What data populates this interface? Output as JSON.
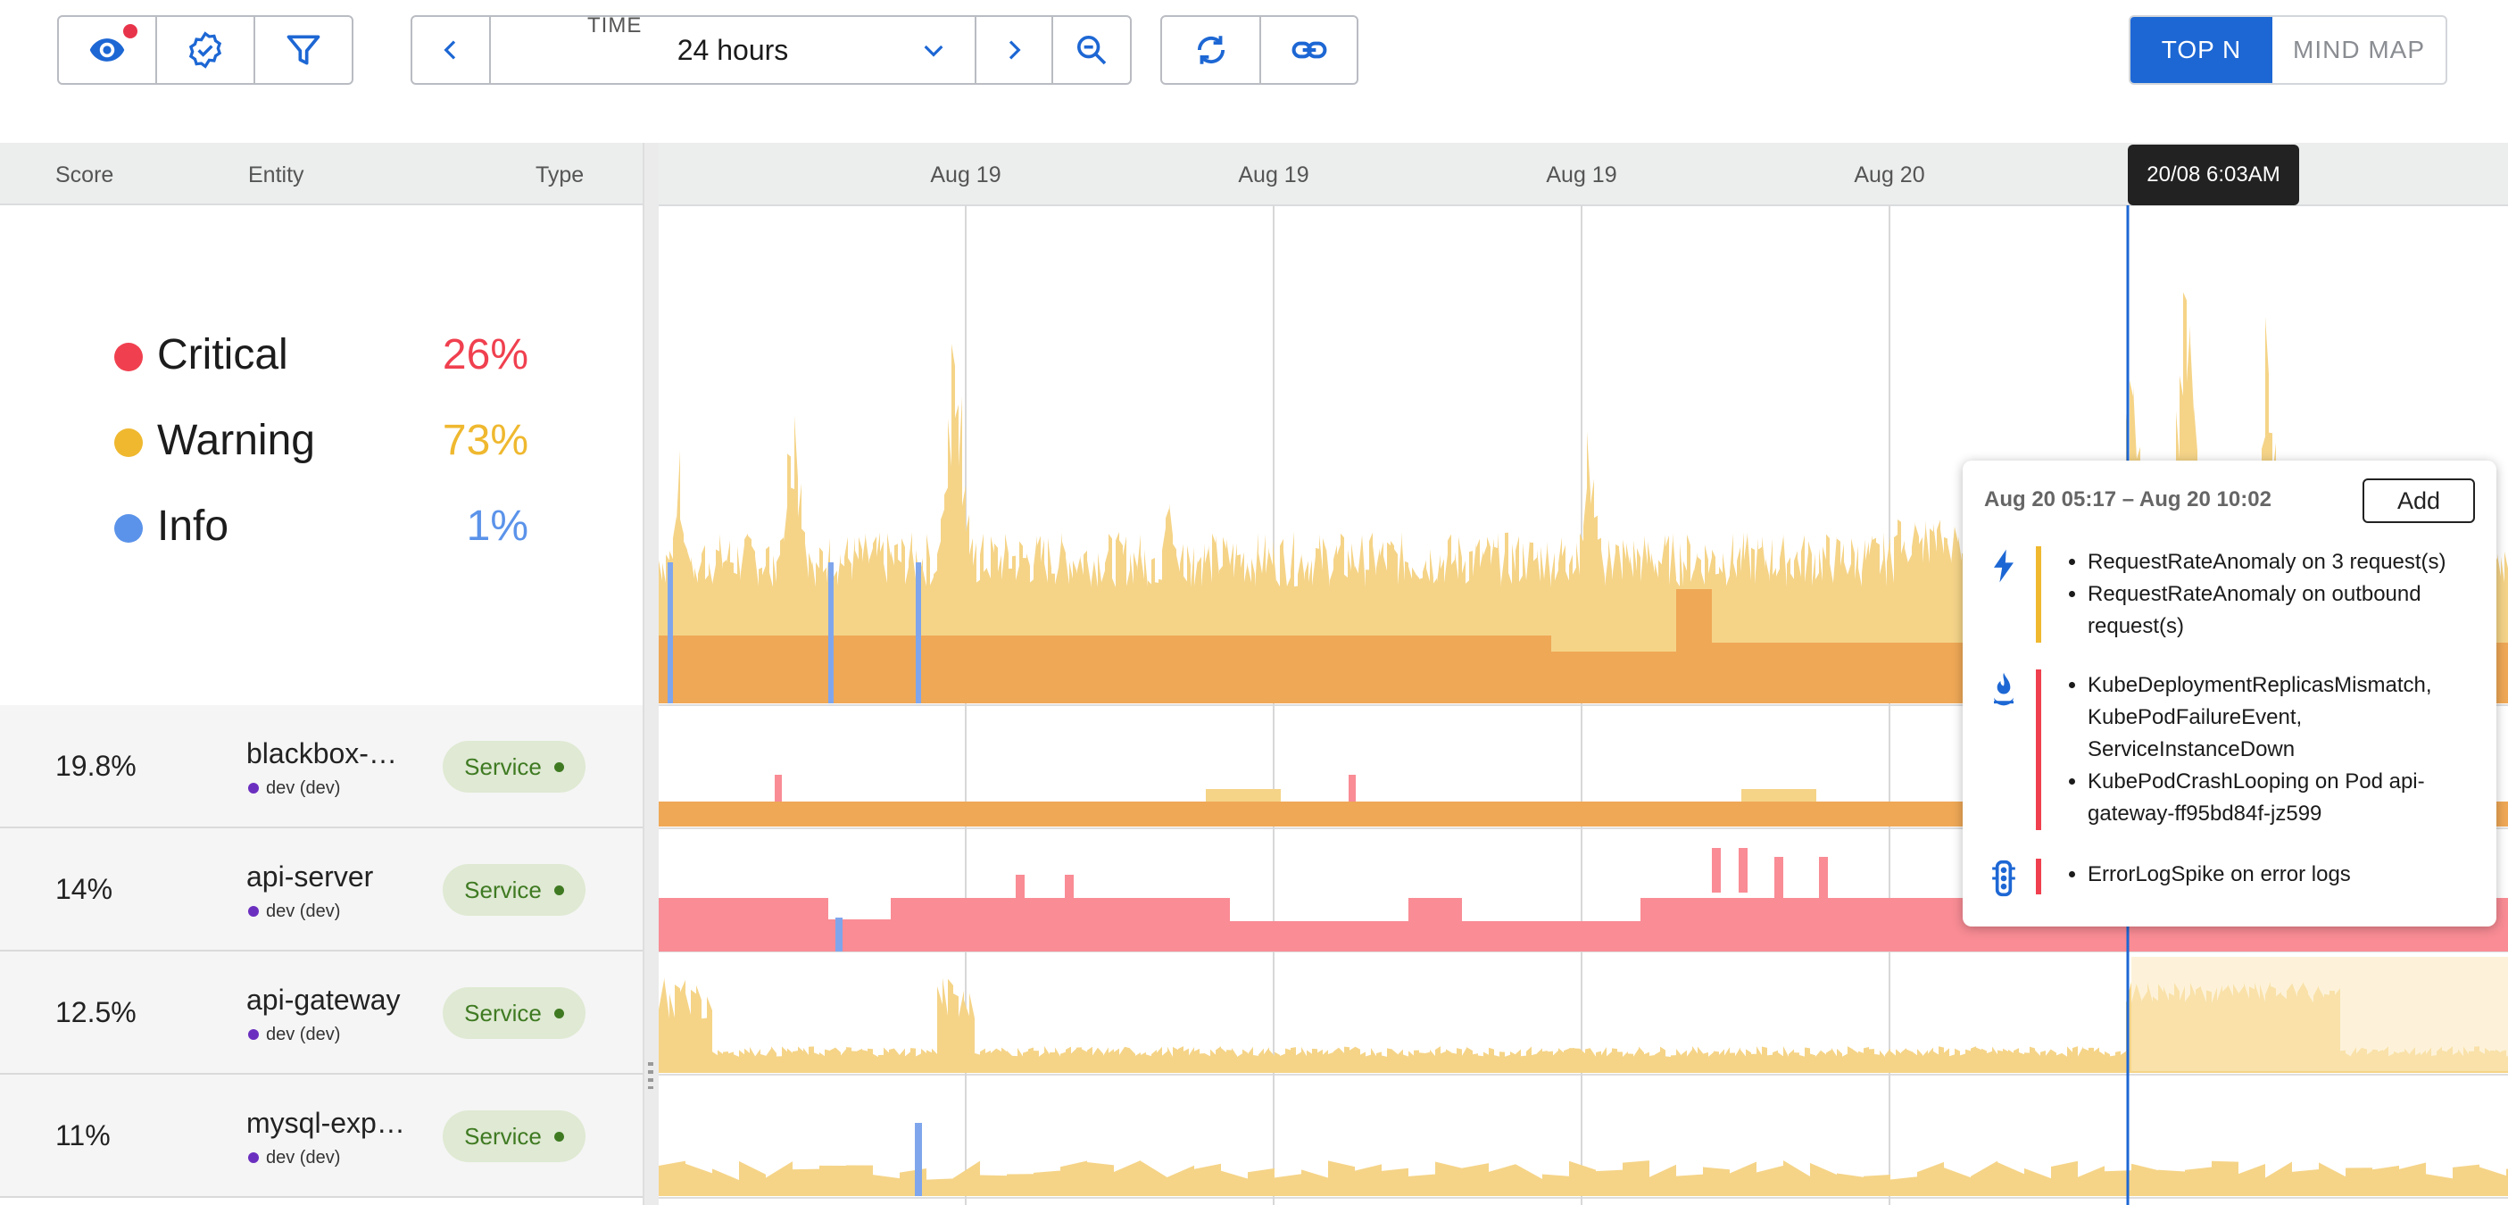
{
  "toolbar": {
    "group1": [
      {
        "icon": "eye-icon"
      },
      {
        "icon": "verified-badge-icon"
      },
      {
        "icon": "filter-icon"
      }
    ],
    "time": {
      "legend": "TIME",
      "value": "24 hours"
    },
    "prev_icon": "chevron-left-icon",
    "next_icon": "chevron-right-icon",
    "zoom_icon": "zoom-out-icon",
    "refresh_icon": "refresh-icon",
    "link_icon": "link-icon",
    "view_toggle": {
      "active": "TOP N",
      "inactive": "MIND MAP"
    }
  },
  "table": {
    "headers": {
      "score": "Score",
      "entity": "Entity",
      "type": "Type"
    },
    "rows": [
      {
        "score": "19.8%",
        "name": "blackbox-…",
        "env": "dev (dev)",
        "type": "Service"
      },
      {
        "score": "14%",
        "name": "api-server",
        "env": "dev (dev)",
        "type": "Service"
      },
      {
        "score": "12.5%",
        "name": "api-gateway",
        "env": "dev (dev)",
        "type": "Service"
      },
      {
        "score": "11%",
        "name": "mysql-exp…",
        "env": "dev (dev)",
        "type": "Service"
      }
    ]
  },
  "legend": [
    {
      "label": "Critical",
      "pct": "26%",
      "color": "#f0404f"
    },
    {
      "label": "Warning",
      "pct": "73%",
      "color": "#efb82f"
    },
    {
      "label": "Info",
      "pct": "1%",
      "color": "#5b93ea"
    }
  ],
  "timeline": {
    "ticks": [
      "Aug 19",
      "Aug 19",
      "Aug 19",
      "Aug 20"
    ],
    "cursor_label": "20/08 6:03AM"
  },
  "colors": {
    "warning_fill": "#f5d488",
    "warning_dark": "#efa856",
    "critical_fill": "#f98c95",
    "info_fill": "#7fa6ec",
    "accent": "#1d67d4"
  },
  "popup": {
    "range": "Aug 20 05:17 – Aug 20 10:02",
    "add_label": "Add",
    "groups": [
      {
        "icon": "lightning-icon",
        "severity": "warning",
        "items": [
          "RequestRateAnomaly on 3 request(s)",
          "RequestRateAnomaly on outbound request(s)"
        ]
      },
      {
        "icon": "flame-icon",
        "severity": "critical",
        "items": [
          "KubeDeploymentReplicasMismatch, KubePodFailureEvent, ServiceInstanceDown",
          "KubePodCrashLooping on Pod api-gateway-ff95bd84f-jz599"
        ]
      },
      {
        "icon": "traffic-light-icon",
        "severity": "critical",
        "items": [
          "ErrorLogSpike on error logs"
        ]
      }
    ]
  }
}
